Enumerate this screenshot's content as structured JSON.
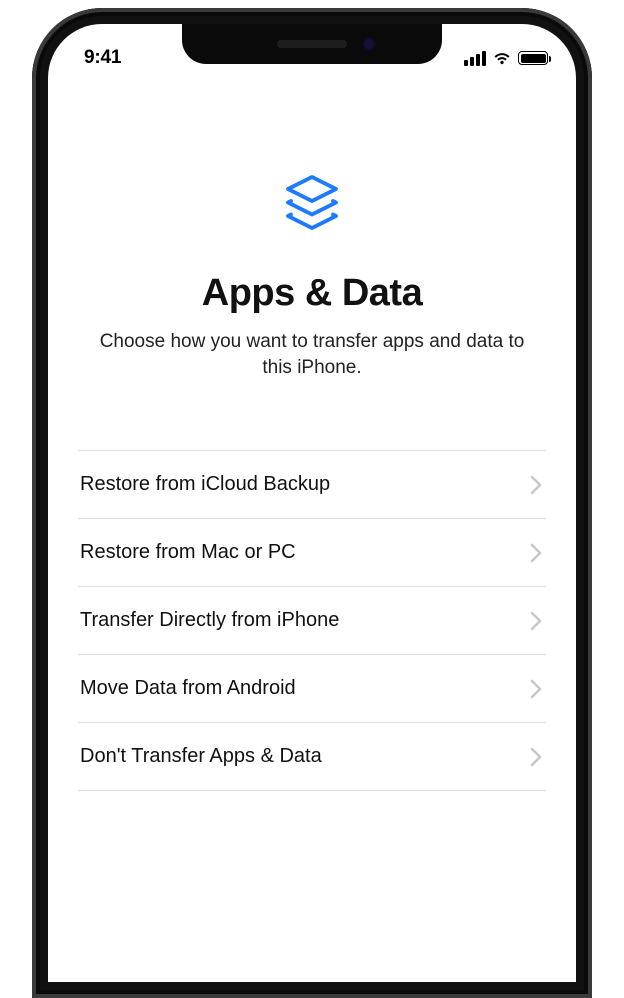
{
  "status": {
    "time": "9:41"
  },
  "header": {
    "title": "Apps & Data",
    "subtitle": "Choose how you want to transfer apps and data to this iPhone."
  },
  "options": [
    {
      "label": "Restore from iCloud Backup"
    },
    {
      "label": "Restore from Mac or PC"
    },
    {
      "label": "Transfer Directly from iPhone"
    },
    {
      "label": "Move Data from Android"
    },
    {
      "label": "Don't Transfer Apps & Data"
    }
  ],
  "colors": {
    "accent": "#1e7bff",
    "chevron": "#c7c7cc",
    "divider": "#e0e0e0"
  }
}
